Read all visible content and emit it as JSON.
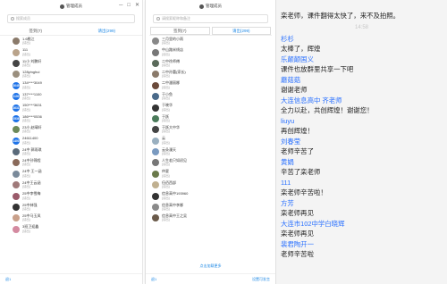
{
  "colors": {
    "accent": "#1e88e5",
    "sender": "#2970ff",
    "avatar_blue": "#1e73e8"
  },
  "win1": {
    "title": "管理成员",
    "controls": {
      "minimize": "─",
      "maximize": "□",
      "close": "✕"
    },
    "search_placeholder": "搜索成员",
    "tabs": [
      "签到(7)",
      "请出(299)"
    ],
    "members": [
      {
        "name": "1.6桃江",
        "status": "(请出)",
        "avatar": "photo",
        "color": "#8a7a6a",
        "initials": ""
      },
      {
        "name": "111",
        "status": "(请出)",
        "avatar": "photo",
        "color": "#b9a38a",
        "initials": ""
      },
      {
        "name": "11小 刘鹏轩",
        "status": "(请出)",
        "avatar": "photo",
        "color": "#444",
        "initials": ""
      },
      {
        "name": "128yinghui",
        "status": "(请出)",
        "avatar": "photo",
        "color": "#9a8f7e",
        "initials": ""
      },
      {
        "name": "134****3049",
        "status": "(请出)",
        "avatar": "initials",
        "color": "#1e73e8",
        "initials": "3049"
      },
      {
        "name": "137****1100",
        "status": "(请出)",
        "avatar": "initials",
        "color": "#1e73e8",
        "initials": "1100"
      },
      {
        "name": "150****3631",
        "status": "(请出)",
        "avatar": "initials",
        "color": "#1e73e8",
        "initials": "3631"
      },
      {
        "name": "186****0536",
        "status": "(请出)",
        "avatar": "initials",
        "color": "#1e73e8",
        "initials": "0536"
      },
      {
        "name": "23小 赵晴轩",
        "status": "(请出)",
        "avatar": "photo",
        "color": "#6d8a5a",
        "initials": ""
      },
      {
        "name": "24611400",
        "status": "(请出)",
        "avatar": "initials",
        "color": "#1e73e8",
        "initials": "1400"
      },
      {
        "name": "24中 郭雨琪",
        "status": "(请出)",
        "avatar": "photo",
        "color": "#5a6a7a",
        "initials": ""
      },
      {
        "name": "24中孙锦程",
        "status": "(请出)",
        "avatar": "photo",
        "color": "#8a6a5a",
        "initials": ""
      },
      {
        "name": "24中 王一涵",
        "status": "(请出)",
        "avatar": "photo",
        "color": "#7a8a9a",
        "initials": ""
      },
      {
        "name": "24中王云涵",
        "status": "(请出)",
        "avatar": "photo",
        "color": "#a07a7a",
        "initials": ""
      },
      {
        "name": "25中李雪梅",
        "status": "(请出)",
        "avatar": "photo",
        "color": "#9a5a6a",
        "initials": ""
      },
      {
        "name": "25中林强",
        "status": "(请出)",
        "avatar": "photo",
        "color": "#333",
        "initials": ""
      },
      {
        "name": "25中马玉凤",
        "status": "(请出)",
        "avatar": "photo",
        "color": "#c9a08a",
        "initials": ""
      },
      {
        "name": "3班卫迎鑫",
        "status": "(请出)",
        "avatar": "photo",
        "color": "#d48aa0",
        "initials": ""
      }
    ],
    "footer_left": "退1"
  },
  "win2": {
    "title": "管理成员",
    "search_placeholder": "请搜索昵称和备注",
    "tabs": [
      "签到(7)",
      "请出(299)"
    ],
    "members": [
      {
        "name": "三月里的小雨",
        "status": "(请出)",
        "color": "#888"
      },
      {
        "name": "中山路米线店",
        "status": "(请出)",
        "color": "#777"
      },
      {
        "name": "二中徐师傅",
        "status": "(请出)",
        "color": "#5a6a5a"
      },
      {
        "name": "二中孙蕾(家长)",
        "status": "(请出)",
        "color": "#8a7a6a"
      },
      {
        "name": "二中潘丽娜",
        "status": "(请出)",
        "color": "#6a4a3a"
      },
      {
        "name": "于小鱼",
        "status": "(请出)",
        "color": "#4a6a8a"
      },
      {
        "name": "于晓华",
        "status": "(请出)",
        "color": "#333"
      },
      {
        "name": "于跃",
        "status": "(请出)",
        "color": "#4a7a5a"
      },
      {
        "name": "于跃大中华",
        "status": "(请出)",
        "color": "#444"
      },
      {
        "name": "云",
        "status": "(请出)",
        "color": "#9ab0c0"
      },
      {
        "name": "云朵漫天",
        "status": "(请出)",
        "color": "#7a9ac0"
      },
      {
        "name": "人生若只如初见",
        "status": "(请出)",
        "color": "#777"
      },
      {
        "name": "仲夏",
        "status": "(请出)",
        "color": "#6a7a4a"
      },
      {
        "name": "伍佰西部",
        "status": "(请出)",
        "color": "#c0b090"
      },
      {
        "name": "信息高中193960",
        "status": "(请出)",
        "color": "#333"
      },
      {
        "name": "信息高中李娜",
        "status": "(请出)",
        "color": "#8a8a8a"
      },
      {
        "name": "信息高中王之吴",
        "status": "(请出)",
        "color": "#6a5a4a"
      }
    ],
    "load_more": "点击加载更多",
    "footer_left": "退1",
    "footer_right": "设置可发言"
  },
  "chat": {
    "messages": [
      {
        "type": "text",
        "text": "栾老师，课件翻得太快了，来不及拍照。"
      },
      {
        "type": "sender",
        "text": "杉杉"
      },
      {
        "type": "text",
        "text": "太棒了，辉煌"
      },
      {
        "type": "sender",
        "text": "乐颠颠国义"
      },
      {
        "type": "text",
        "text": "课件也放群里共享一下吧"
      },
      {
        "type": "sender",
        "text": "蘑菇菇"
      },
      {
        "type": "text",
        "text": "谢谢老师"
      },
      {
        "type": "sender",
        "text": "大连信息高中  齐老师"
      },
      {
        "type": "text",
        "text": "全力以赴，共创辉煌！谢谢您！"
      },
      {
        "type": "sender",
        "text": "liuyu"
      },
      {
        "type": "text",
        "text": "再创辉煌！"
      },
      {
        "type": "sender",
        "text": "刘春莹"
      },
      {
        "type": "text",
        "text": "老师辛苦了"
      },
      {
        "type": "sender",
        "text": "黄娟"
      },
      {
        "type": "text",
        "text": "辛苦了栾老师"
      },
      {
        "type": "sender",
        "text": "111"
      },
      {
        "type": "text",
        "text": "栾老师辛苦啦！"
      },
      {
        "type": "sender",
        "text": "方芳"
      },
      {
        "type": "text",
        "text": "栾老师再见"
      },
      {
        "type": "sender",
        "text": "大连市102中学白晓辉"
      },
      {
        "type": "text",
        "text": "栾老师再见"
      },
      {
        "type": "sender",
        "text": "裴君陶开一"
      },
      {
        "type": "text",
        "text": "老师辛苦啦"
      }
    ],
    "timestamp": "14:58"
  }
}
